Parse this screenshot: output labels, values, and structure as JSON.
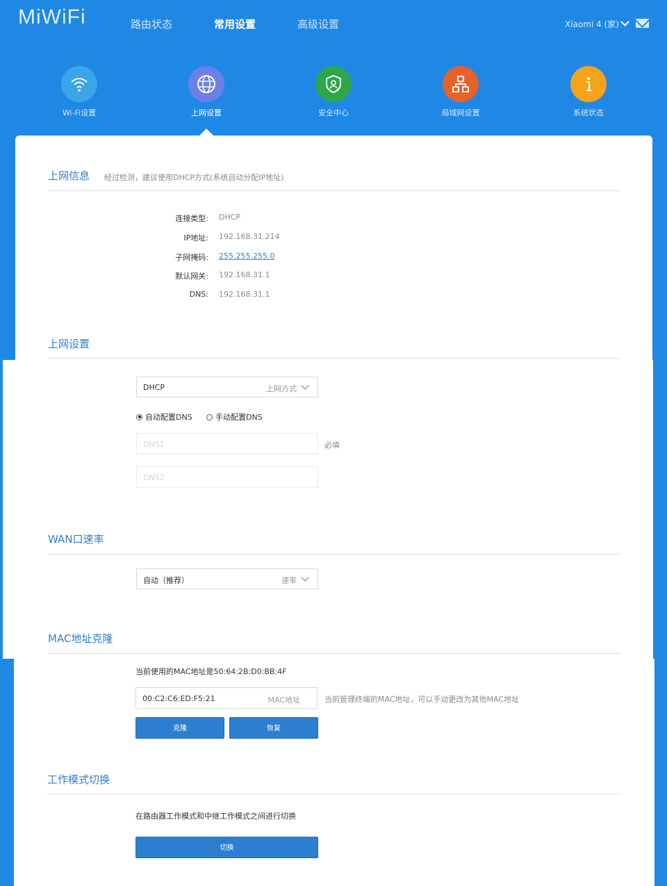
{
  "header": {
    "logo": "MiWiFi",
    "nav": [
      "路由状态",
      "常用设置",
      "高级设置"
    ],
    "active_nav": "常用设置",
    "device": "Xiaomi 4 (家)",
    "icons": {
      "dropdown": "chevron-down-icon",
      "mail": "mail-icon"
    }
  },
  "tiles": [
    {
      "label": "Wi-Fi设置",
      "color": "#3aa5e8",
      "icon": "wifi-icon"
    },
    {
      "label": "上网设置",
      "color": "#6b7fe8",
      "icon": "globe-icon"
    },
    {
      "label": "安全中心",
      "color": "#2ea74a",
      "icon": "shield-icon"
    },
    {
      "label": "局域网设置",
      "color": "#e5632b",
      "icon": "network-icon"
    },
    {
      "label": "系统状态",
      "color": "#f5a31a",
      "icon": "info-icon"
    }
  ],
  "info": {
    "title": "上网信息",
    "subtitle": "经过检测，建议使用DHCP方式(系统自动分配IP地址)",
    "rows": [
      {
        "label": "连接类型:",
        "value": "DHCP"
      },
      {
        "label": "IP地址:",
        "value": "192.168.31.214"
      },
      {
        "label": "子网掩码:",
        "value": "255.255.255.0"
      },
      {
        "label": "默认网关:",
        "value": "192.168.31.1"
      },
      {
        "label": "DNS:",
        "value": "192.168.31.1"
      }
    ]
  },
  "wan": {
    "title": "上网设置",
    "mode_value": "DHCP",
    "mode_hint": "上网方式",
    "dns_auto": "自动配置DNS",
    "dns_manual": "手动配置DNS",
    "dns1_placeholder": "DNS1",
    "dns1_required": "必填",
    "dns2_placeholder": "DNS2"
  },
  "speed": {
    "title": "WAN口速率",
    "value": "自动（推荐）",
    "hint": "速率"
  },
  "mac": {
    "title": "MAC地址克隆",
    "current": "当前使用的MAC地址是50:64:2B:D0:BB:4F",
    "input_value": "00:C2:C6:ED:F5:21",
    "input_hint": "MAC地址",
    "help": "当前管理终端的MAC地址，可以手动更改为其他MAC地址",
    "clone_btn": "克隆",
    "restore_btn": "恢复"
  },
  "mode": {
    "title": "工作模式切换",
    "desc": "在路由器工作模式和中继工作模式之间进行切换",
    "switch_btn": "切换"
  }
}
